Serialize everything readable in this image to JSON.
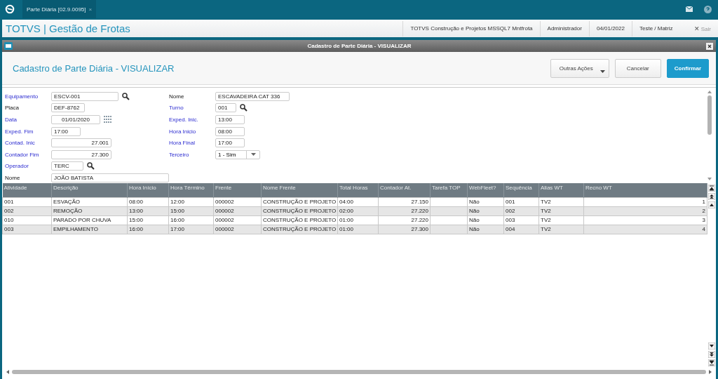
{
  "top_bar": {
    "tabs": [
      {
        "label": "Parte Diária [02.9.0095]",
        "close": "×",
        "selected": true
      }
    ]
  },
  "header": {
    "title": "TOTVS | Gestão de Frotas",
    "info": [
      "TOTVS Construção e Projetos MSSQL7 Mntfrota",
      "Administrador",
      "04/01/2022",
      "Teste / Matriz"
    ],
    "exit_icon": "✕",
    "exit": "Sair"
  },
  "dialog": {
    "title": "Cadastro de Parte Diária - VISUALIZAR",
    "heading": "Cadastro de Parte Diária - VISUALIZAR",
    "buttons": [
      {
        "label": "Outras Ações",
        "kind": "menu"
      },
      {
        "label": "Cancelar",
        "kind": "plain"
      },
      {
        "label": "Confirmar",
        "kind": "primary"
      }
    ]
  },
  "form": {
    "left": [
      {
        "label": "Equipamento",
        "required": true,
        "value": "ESCV-001",
        "kind": "lookup"
      },
      {
        "label": "Placa",
        "required": false,
        "value": "DEF-8762",
        "kind": "text"
      },
      {
        "label": "Data",
        "required": true,
        "value": "01/01/2020",
        "kind": "date"
      },
      {
        "label": "Exped. Fim",
        "required": true,
        "value": "17:00",
        "kind": "text"
      },
      {
        "label": "Contad. Inic",
        "required": true,
        "value": "27.001",
        "kind": "number"
      },
      {
        "label": "Contador Fim",
        "required": true,
        "value": "27.300",
        "kind": "number"
      },
      {
        "label": "Operador",
        "required": true,
        "value": "TERC",
        "kind": "lookup"
      },
      {
        "label": "Nome",
        "required": false,
        "value": "JOÃO BATISTA",
        "kind": "wide"
      }
    ],
    "right": [
      {
        "label": "Nome",
        "required": false,
        "value": "ESCAVADEIRA CAT 336",
        "kind": "text"
      },
      {
        "label": "Turno",
        "required": true,
        "value": "001",
        "kind": "lookup"
      },
      {
        "label": "Exped. Inic.",
        "required": true,
        "value": "13:00",
        "kind": "text"
      },
      {
        "label": "Hora Inicio",
        "required": true,
        "value": "08:00",
        "kind": "text"
      },
      {
        "label": "Hora Final",
        "required": true,
        "value": "17:00",
        "kind": "text"
      },
      {
        "label": "Terceiro",
        "required": true,
        "value": "1 - Sim",
        "kind": "select"
      }
    ]
  },
  "table": {
    "columns": [
      "Atividade",
      "Descrição",
      "Hora Início",
      "Hora Término",
      "Frente",
      "Nome Frente",
      "Total Horas",
      "Contador At.",
      "Tarefa TOP",
      "WebFleet?",
      "Sequência",
      "Alias WT",
      "Recno WT"
    ],
    "rows": [
      [
        "001",
        "ESVAÇÃO",
        "08:00",
        "12:00",
        "000002",
        "CONSTRUÇÃO E PROJETO",
        "04:00",
        "27.150",
        "",
        "Não",
        "001",
        "TV2",
        "1"
      ],
      [
        "002",
        "REMOÇÃO",
        "13:00",
        "15:00",
        "000002",
        "CONSTRUÇÃO E PROJETO",
        "02:00",
        "27.220",
        "",
        "Não",
        "002",
        "TV2",
        "2"
      ],
      [
        "010",
        "PARADO POR CHUVA",
        "15:00",
        "16:00",
        "000002",
        "CONSTRUÇÃO E PROJETO",
        "01:00",
        "27.220",
        "",
        "Não",
        "003",
        "TV2",
        "3"
      ],
      [
        "003",
        "EMPILHAMENTO",
        "16:00",
        "17:00",
        "000002",
        "CONSTRUÇÃO E PROJETO",
        "01:00",
        "27.300",
        "",
        "Não",
        "004",
        "TV2",
        "4"
      ]
    ]
  }
}
